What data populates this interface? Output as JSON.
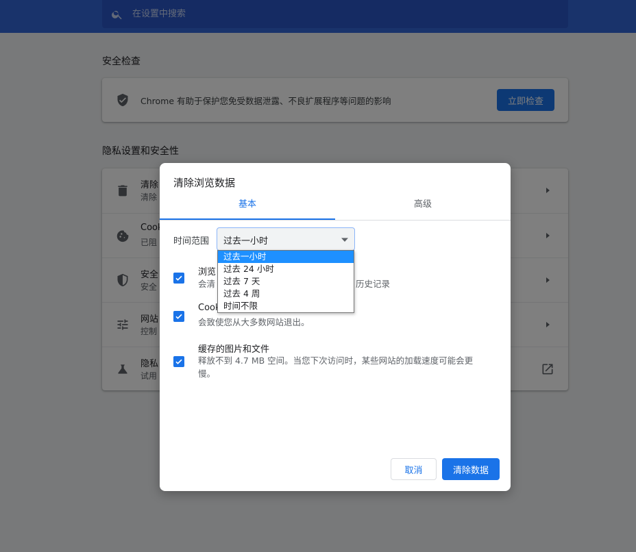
{
  "search": {
    "placeholder": "在设置中搜索"
  },
  "safety_check": {
    "section_title": "安全检查",
    "description": "Chrome 有助于保护您免受数据泄露、不良扩展程序等问题的影响",
    "button_label": "立即检查"
  },
  "privacy": {
    "section_title": "隐私设置和安全性",
    "rows": [
      {
        "title": "清除",
        "subtitle": "清除",
        "icon": "trash-icon"
      },
      {
        "title": "Cook",
        "subtitle": "已阻",
        "icon": "cookie-icon"
      },
      {
        "title": "安全",
        "subtitle": "安全",
        "icon": "shield-icon"
      },
      {
        "title": "网站",
        "subtitle": "控制",
        "icon": "tune-icon"
      },
      {
        "title": "隐私",
        "subtitle": "试用",
        "icon": "flask-icon"
      }
    ]
  },
  "dialog": {
    "title": "清除浏览数据",
    "tabs": [
      {
        "label": "基本",
        "active": true
      },
      {
        "label": "高级",
        "active": false
      }
    ],
    "time_range": {
      "label": "时间范围",
      "selected": "过去一小时",
      "options": [
        "过去一小时",
        "过去 24 小时",
        "过去 7 天",
        "过去 4 周",
        "时间不限"
      ]
    },
    "items": [
      {
        "title": "浏览",
        "description": "会清",
        "description_tail": "历史记录",
        "checked": true
      },
      {
        "title": "Cook",
        "description": "会致使您从大多数网站退出。",
        "checked": true
      },
      {
        "title": "缓存的图片和文件",
        "description": "释放不到 4.7 MB 空间。当您下次访问时，某些网站的加载速度可能会更慢。",
        "checked": true
      }
    ],
    "cancel_label": "取消",
    "confirm_label": "清除数据"
  },
  "colors": {
    "header_blue": "#3367d6",
    "accent": "#1a73e8",
    "dropdown_highlight": "#1e90ff"
  }
}
